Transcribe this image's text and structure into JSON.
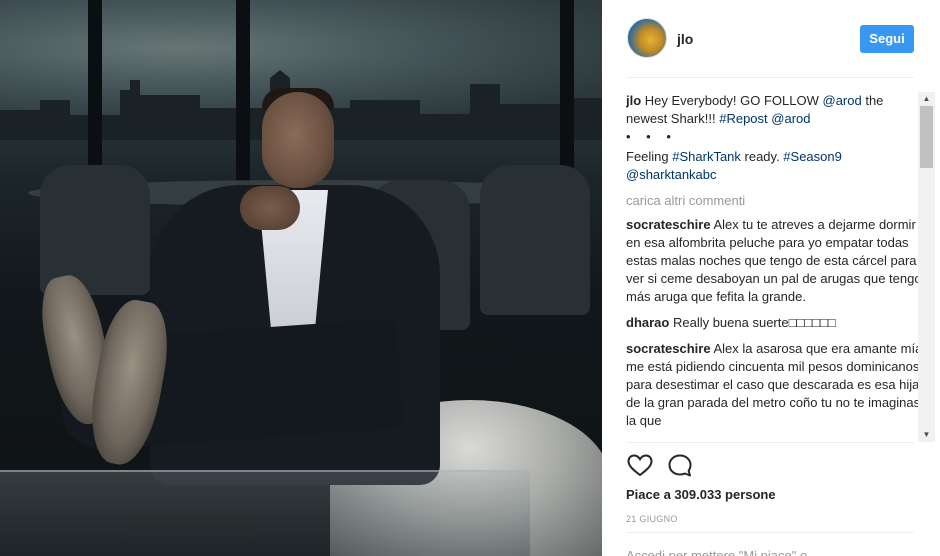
{
  "header": {
    "username": "jlo",
    "follow_label": "Segui"
  },
  "caption": {
    "user": "jlo",
    "text1": " Hey Everybody! GO FOLLOW ",
    "mention1": "@arod",
    "text2": " the newest Shark!!! ",
    "hashtag1": "#Repost",
    "text3": " ",
    "mention2": "@arod",
    "dots": "• • •",
    "text4": "Feeling ",
    "hashtag2": "#SharkTank",
    "text5": " ready. ",
    "hashtag3": "#Season9",
    "mention3": "@sharktankabc"
  },
  "load_more": "carica altri commenti",
  "comments": [
    {
      "user": "socrateschire",
      "text": "Alex tu te atreves a dejarme dormir en esa alfombrita peluche para yo empatar todas estas malas noches que tengo de esta cárcel para ver si ceme desaboyan un pal de arugas que tengo más aruga que fefita la grande."
    },
    {
      "user": "dharao",
      "text": "Really buena suerte□□□□□□"
    },
    {
      "user": "socrateschire",
      "text": "Alex la asarosa que era amante mía me está pidiendo cincuenta mil pesos dominicanos para desestimar el caso que descarada es esa hija de la gran parada del metro coño tu no te imaginas la que"
    }
  ],
  "likes_text": "Piace a 309.033 persone",
  "date": "21 GIUGNO",
  "login_prompt": "Accedi per mettere \"Mi piace\" o",
  "colors": {
    "accent": "#3897f0",
    "link": "#003569",
    "muted": "#999999"
  },
  "icons": [
    "heart-icon",
    "comment-icon"
  ]
}
